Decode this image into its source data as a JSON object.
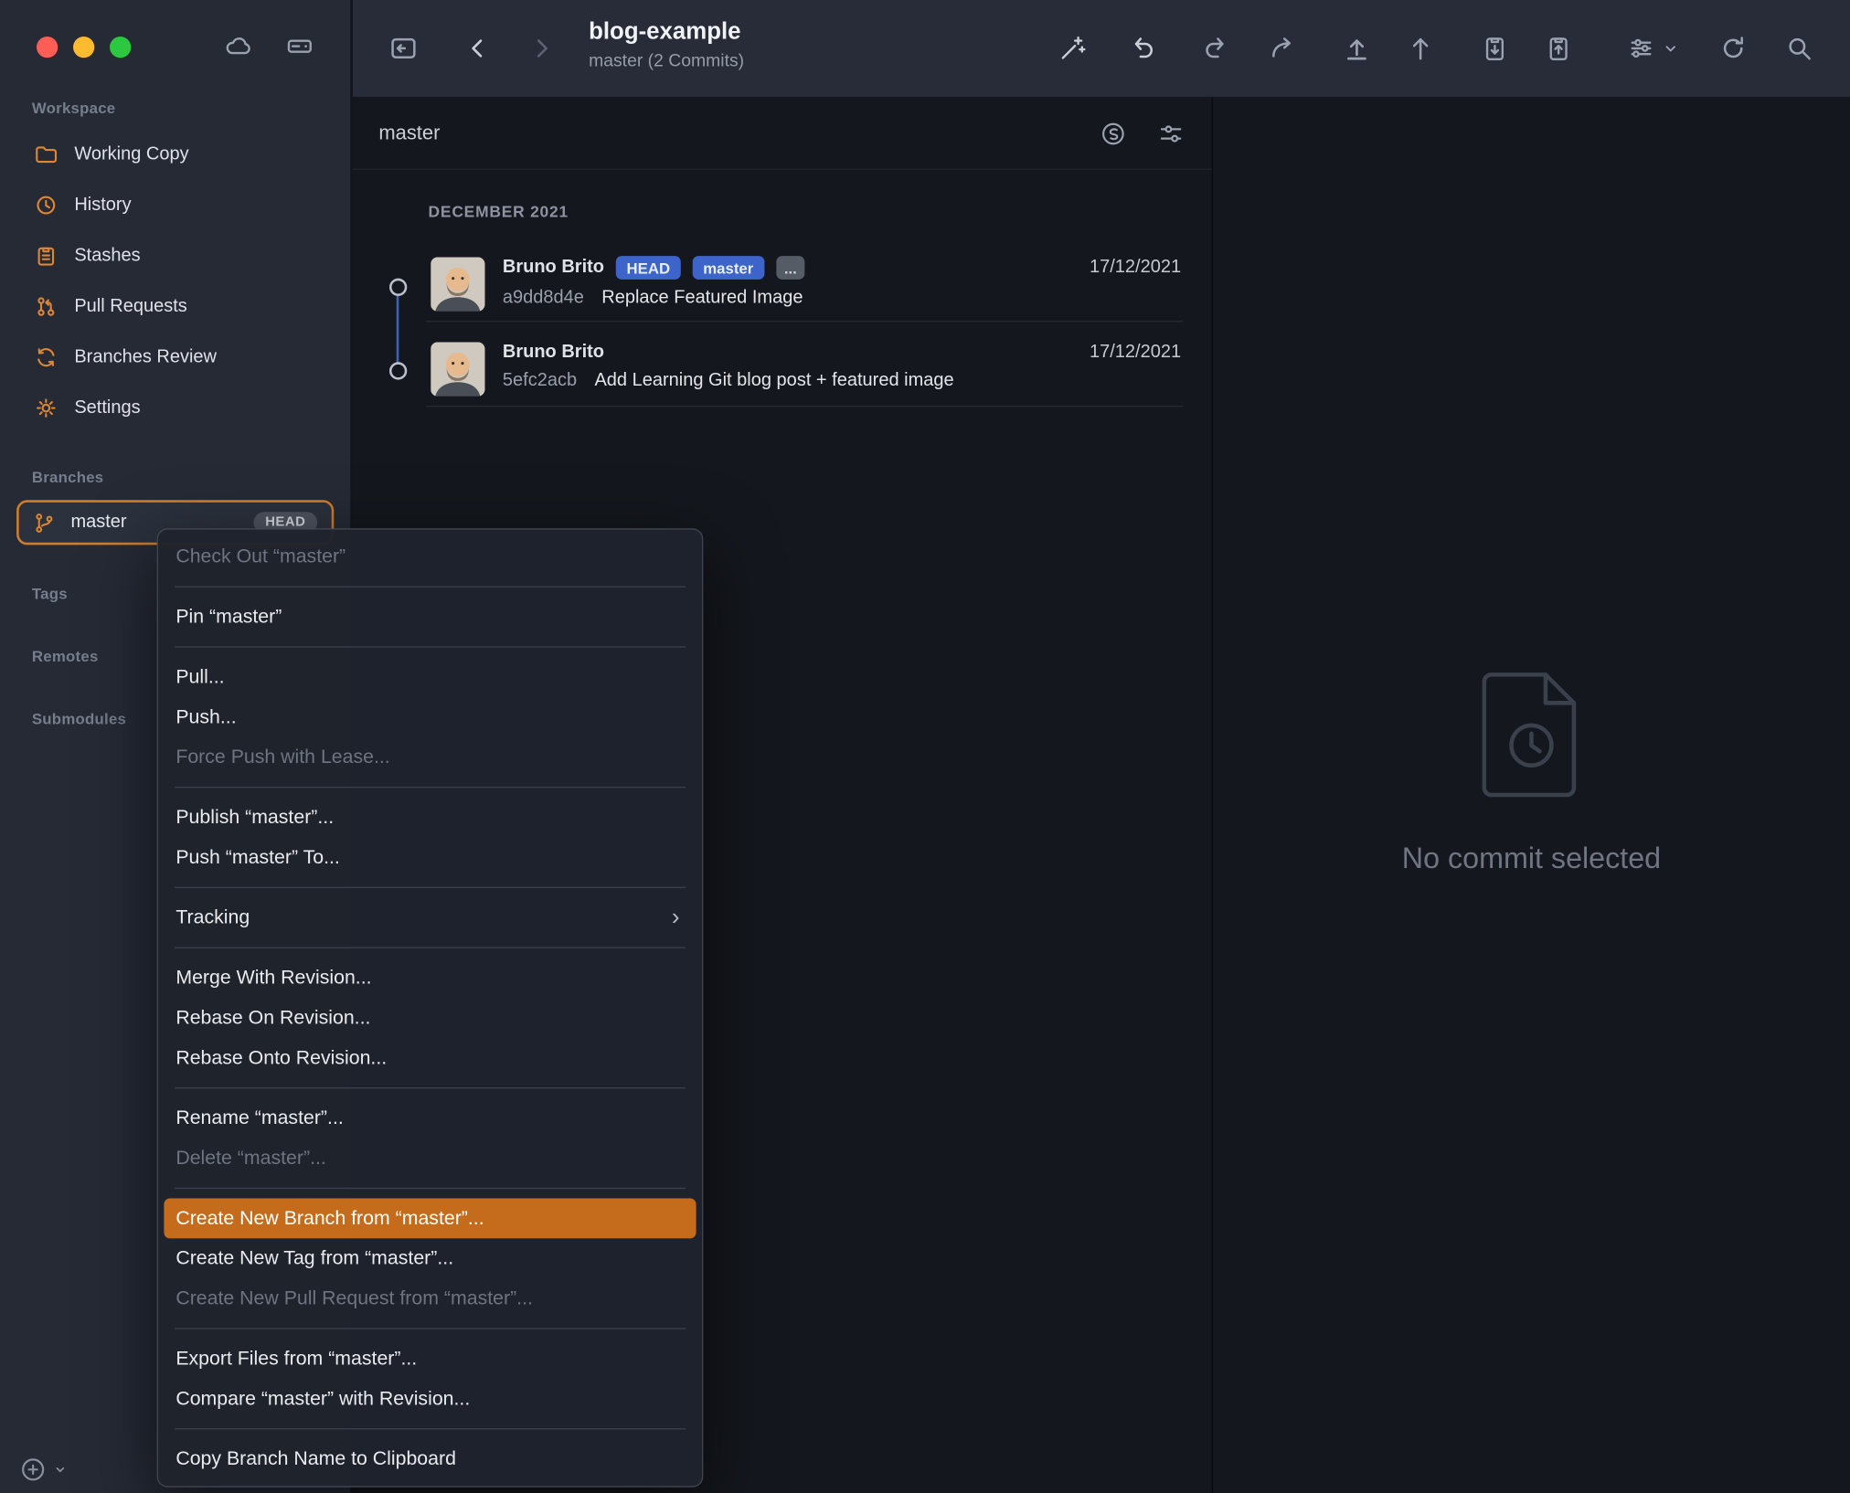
{
  "window": {
    "title": "blog-example",
    "subtitle": "master (2 Commits)"
  },
  "toolbar": {
    "icons": [
      "open-repo-icon",
      "back-icon",
      "forward-icon",
      "quick-actions-wand-icon",
      "undo-icon",
      "redo-icon",
      "fetch-icon",
      "pull-icon",
      "push-icon",
      "stash-save-icon",
      "stash-apply-icon",
      "workflows-icon",
      "workflows-chevron-icon",
      "refresh-icon",
      "search-icon"
    ]
  },
  "sidebar": {
    "workspace_header": "Workspace",
    "workspace_items": [
      {
        "label": "Working Copy",
        "icon": "folder-icon"
      },
      {
        "label": "History",
        "icon": "clock-icon"
      },
      {
        "label": "Stashes",
        "icon": "clipboard-icon"
      },
      {
        "label": "Pull Requests",
        "icon": "pull-request-icon"
      },
      {
        "label": "Branches Review",
        "icon": "branches-review-icon"
      },
      {
        "label": "Settings",
        "icon": "gear-icon"
      }
    ],
    "branches_header": "Branches",
    "branch": {
      "label": "master",
      "badge": "HEAD",
      "icon": "branch-icon"
    },
    "tags_header": "Tags",
    "remotes_header": "Remotes",
    "submodules_header": "Submodules"
  },
  "commit_list": {
    "filter_value": "master",
    "filter_icons": [
      "compare-icon",
      "filter-sliders-icon"
    ],
    "section_header": "DECEMBER 2021",
    "commits": [
      {
        "author": "Bruno Brito",
        "badges": [
          "HEAD",
          "master",
          "..."
        ],
        "date": "17/12/2021",
        "hash": "a9dd8d4e",
        "message": "Replace Featured Image"
      },
      {
        "author": "Bruno Brito",
        "badges": [],
        "date": "17/12/2021",
        "hash": "5efc2acb",
        "message": "Add Learning Git blog post + featured image"
      }
    ]
  },
  "detail_panel": {
    "empty_message": "No commit selected",
    "icon": "document-history-icon"
  },
  "context_menu": {
    "submenu_arrow": "›",
    "items": [
      {
        "label": "Check Out “master”",
        "state": "disabled"
      },
      {
        "label": "Pin “master”",
        "state": "normal"
      },
      {
        "label": "Pull...",
        "state": "normal"
      },
      {
        "label": "Push...",
        "state": "normal"
      },
      {
        "label": "Force Push with Lease...",
        "state": "disabled"
      },
      {
        "label": "Publish “master”...",
        "state": "normal"
      },
      {
        "label": "Push “master” To...",
        "state": "normal"
      },
      {
        "label": "Tracking",
        "state": "normal",
        "submenu": true
      },
      {
        "label": "Merge With Revision...",
        "state": "normal"
      },
      {
        "label": "Rebase On Revision...",
        "state": "normal"
      },
      {
        "label": "Rebase Onto Revision...",
        "state": "normal"
      },
      {
        "label": "Rename “master”...",
        "state": "normal"
      },
      {
        "label": "Delete “master”...",
        "state": "disabled"
      },
      {
        "label": "Create New Branch from “master”...",
        "state": "highlighted"
      },
      {
        "label": "Create New Tag from “master”...",
        "state": "normal"
      },
      {
        "label": "Create New Pull Request from “master”...",
        "state": "disabled"
      },
      {
        "label": "Export Files from “master”...",
        "state": "normal"
      },
      {
        "label": "Compare “master” with Revision...",
        "state": "normal"
      },
      {
        "label": "Copy Branch Name to Clipboard",
        "state": "normal"
      }
    ]
  },
  "colors": {
    "accent_orange": "#dd8634",
    "selection_border": "#cf7c2e",
    "badge_blue": "#3d64c8",
    "menu_highlight": "#c46c1b",
    "sidebar_bg": "#252a35",
    "content_bg": "#14171d"
  }
}
